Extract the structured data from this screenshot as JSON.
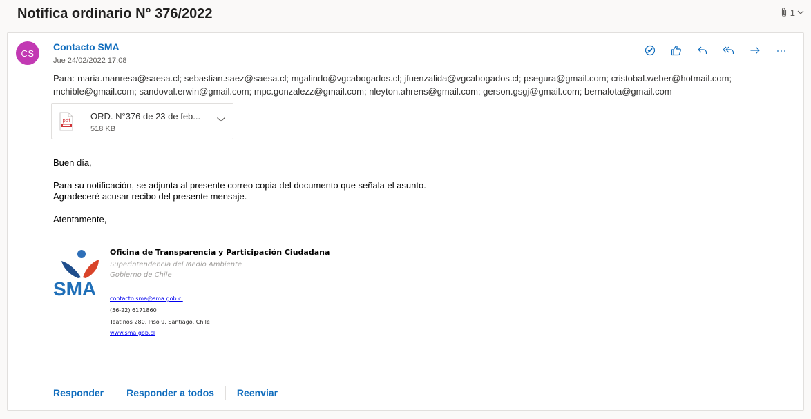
{
  "subject": "Notifica ordinario N° 376/2022",
  "attachment_count": "1",
  "colors": {
    "accent": "#0f6cbd",
    "avatar_bg": "#c239b3"
  },
  "message": {
    "avatar_initials": "CS",
    "sender": "Contacto SMA",
    "date": "Jue 24/02/2022 17:08",
    "to_label": "Para:",
    "recipients": "maria.manresa@saesa.cl; sebastian.saez@saesa.cl; mgalindo@vgcabogados.cl; jfuenzalida@vgcabogados.cl; psegura@gmail.com; cristobal.weber@hotmail.com; mchible@gmail.com; sandoval.erwin@gmail.com; mpc.gonzalezz@gmail.com; nleyton.ahrens@gmail.com; gerson.gsgj@gmail.com; bernalota@gmail.com",
    "actions": [
      "immersive-reader-icon",
      "like-icon",
      "reply-icon",
      "reply-all-icon",
      "forward-icon",
      "more-icon"
    ]
  },
  "attachment": {
    "name": "ORD. N°376 de 23 de feb...",
    "size": "518 KB",
    "icon_label": "pdf"
  },
  "body": {
    "greeting": "Buen día,",
    "line1": "Para su notificación, se adjunta al presente correo copia del documento que señala el asunto.",
    "line2": "Agradeceré acusar recibo del presente mensaje.",
    "closing": "Atentamente,"
  },
  "signature": {
    "logo_text": "SMA",
    "org": "Oficina de Transparencia y Participación Ciudadana",
    "sub1": "Superintendencia del Medio Ambiente",
    "sub2": "Gobierno de Chile",
    "email": "contacto.sma@sma.gob.cl",
    "phone": "(56-22) 6171860",
    "address": "Teatinos 280, Piso 9, Santiago, Chile",
    "web": "www.sma.gob.cl"
  },
  "footer": {
    "reply": "Responder",
    "reply_all": "Responder a todos",
    "forward": "Reenviar"
  }
}
